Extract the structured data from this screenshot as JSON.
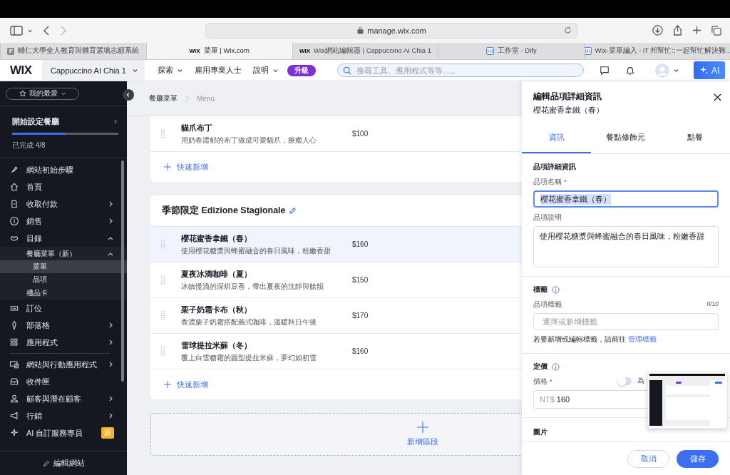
{
  "browser": {
    "url": "manage.wix.com",
    "tabs": [
      {
        "title": "輔仁大學全人教育與體育選填志願系統",
        "favicon": "F",
        "selected": false
      },
      {
        "title": "菜單 | Wix.com",
        "favicon": "WIX",
        "selected": true
      },
      {
        "title": "Wix網站編輯器 | Cappuccino AI Chia 1",
        "favicon": "WIX",
        "selected": false
      },
      {
        "title": "工作室 - Dify",
        "selected": false
      },
      {
        "title": "Wix-菜單編入 - iT 邦幫忙::一起幫忙解決難...",
        "selected": false
      }
    ]
  },
  "header": {
    "logo": "WIX",
    "site": "Cappuccino AI Chia 1",
    "nav": [
      {
        "label": "探索",
        "dropdown": true
      },
      {
        "label": "雇用專業人士",
        "dropdown": false
      },
      {
        "label": "說明",
        "dropdown": true
      }
    ],
    "upgrade": "升級",
    "search": {
      "placeholder": "搜尋工具、應用程式等等......"
    },
    "ai": "AI"
  },
  "sidebar": {
    "favorites": "我的最愛",
    "setup": {
      "title": "開始設定餐廳",
      "level": 0.5,
      "progress": "已完成 4/8"
    },
    "groups": [
      [
        {
          "label": "網站初始步驟",
          "selected": false
        },
        {
          "label": "首頁",
          "selected": false
        },
        {
          "label": "收取付款",
          "selected": false,
          "expanded": false
        },
        {
          "label": "銷售",
          "selected": false,
          "expanded": false
        },
        {
          "label": "目錄",
          "selected": false,
          "expanded": true,
          "children": [
            {
              "label": "餐廳菜單（新）",
              "selected": false,
              "expanded": true,
              "children": [
                {
                  "label": "菜單",
                  "selected": true
                },
                {
                  "label": "品項",
                  "selected": false
                }
              ]
            },
            {
              "label": "禮品卡",
              "selected": false
            }
          ]
        },
        {
          "label": "訂位",
          "selected": false
        },
        {
          "label": "部落格",
          "selected": false,
          "expanded": false
        },
        {
          "label": "應用程式",
          "selected": false,
          "expanded": false
        }
      ],
      [
        {
          "label": "網站與行動應用程式",
          "selected": false,
          "expanded": false
        },
        {
          "label": "收件匣",
          "selected": false
        },
        {
          "label": "顧客與潛在顧客",
          "selected": false,
          "expanded": false
        },
        {
          "label": "行銷",
          "selected": false,
          "expanded": false
        },
        {
          "label": "AI 自訂服務專員",
          "selected": false,
          "badge": "新"
        }
      ]
    ],
    "edit_site": "編輯網站"
  },
  "breadcrumb": [
    "餐廳菜單",
    "Menù"
  ],
  "sections": [
    {
      "items": [
        {
          "name": "貓爪布丁",
          "description": "用奶春濃郁的布丁做成可愛貓爪，療癒人心",
          "price": "$100",
          "selected": false
        }
      ],
      "quick_add": "快速新增"
    },
    {
      "title": "季節限定 Edizione Stagionale",
      "items": [
        {
          "name": "櫻花蜜香拿鐵（春）",
          "description": "使用櫻花糖漿與蜂蜜融合的春日風味，粉嫩香甜",
          "price": "$160",
          "selected": true
        },
        {
          "name": "夏夜冰滴咖啡（夏）",
          "description": "冰鎮慢滴的深烘豆香，帶出夏夜的沈靜與餘韻",
          "price": "$150",
          "selected": false
        },
        {
          "name": "栗子奶霜卡布（秋）",
          "description": "香濃栗子奶霜搭配義式咖啡，溫暖秋日午後",
          "price": "$170",
          "selected": false
        },
        {
          "name": "雪球提拉米蘇（冬）",
          "description": "覆上白雪糖霜的圓型提拉米蘇，夢幻如初雪",
          "price": "$160",
          "selected": false
        }
      ],
      "quick_add": "快速新增"
    }
  ],
  "add_section": "新增區段",
  "panel": {
    "title": "編輯品項詳細資訊",
    "subtitle": "櫻花蜜香拿鐵（春）",
    "tabs": [
      {
        "label": "資訊",
        "selected": true
      },
      {
        "label": "餐點修飾元",
        "selected": false
      },
      {
        "label": "點餐",
        "selected": false
      }
    ],
    "details": {
      "heading": "品項詳細資訊",
      "name_label": "品項名稱",
      "name_required_mark": "*",
      "name_value": "櫻花蜜香拿鐵（春）",
      "description_label": "品項說明",
      "description_value": "使用櫻花糖漿與蜂蜜融合的春日風味，粉嫩香甜"
    },
    "tags": {
      "heading": "標籤",
      "label": "品項標籤",
      "count": "0/10",
      "placeholder": "選擇或新增標籤",
      "help": "若要新增或編輯標籤，請前往",
      "link": "管理標籤"
    },
    "pricing": {
      "heading": "定價",
      "label": "價格",
      "required_mark": "*",
      "toggle_on": false,
      "toggle_label": "為",
      "currency": "NT$",
      "value": "160"
    },
    "images": {
      "heading": "圖片"
    },
    "cancel": "取消",
    "save": "儲存"
  }
}
